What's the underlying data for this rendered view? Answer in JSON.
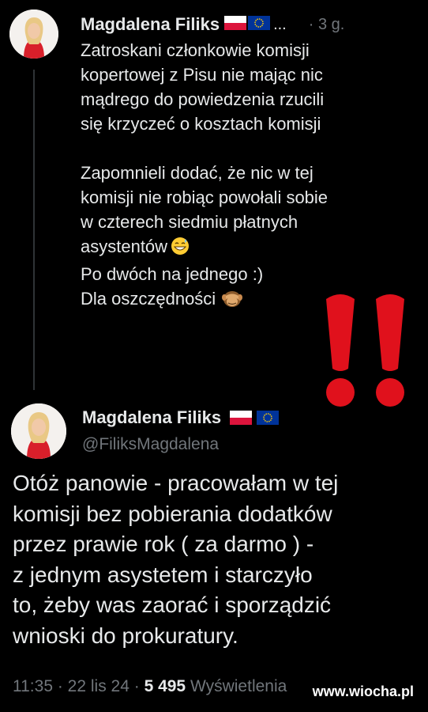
{
  "reply": {
    "author_name": "Magdalena Filiks",
    "ellipsis": "...",
    "time": "· 3 g.",
    "text": "Zatroskani członkowie komisji\nkopertowej z Pisu nie mając nic\nmądrego do powiedzenia rzucili\nsię krzyczeć o kosztach komisji\n\nZapomnieli dodać, że nic w tej\nkomisji nie robiąc powołali sobie\nw czterech siedmiu płatnych\nasystentów",
    "text_tail_1": "Po dwóch na jednego :)",
    "text_tail_2": "Dla oszczędności"
  },
  "post": {
    "author_name": "Magdalena Filiks",
    "handle": "@FiliksMagdalena",
    "text": "Otóż panowie - pracowałam w tej\nkomisji bez pobierania dodatków\nprzez prawie rok ( za darmo ) -\nz jednym asystetem i starczyło\nto, żeby was zaorać i sporządzić\nwnioski do prokuratury.",
    "time": "11:35",
    "date": "22 lis 24",
    "views": "5 495",
    "views_label": "Wyświetlenia"
  },
  "watermark": "www.wiocha.pl",
  "icons": [
    "poland-flag-icon",
    "eu-flag-icon",
    "grinning-sweat-emoji-icon",
    "see-no-evil-monkey-emoji-icon",
    "red-exclamation-icon"
  ],
  "colors": {
    "background": "#000000",
    "text": "#e7e9ea",
    "muted": "#71767b",
    "exclamation": "#e0111c"
  }
}
